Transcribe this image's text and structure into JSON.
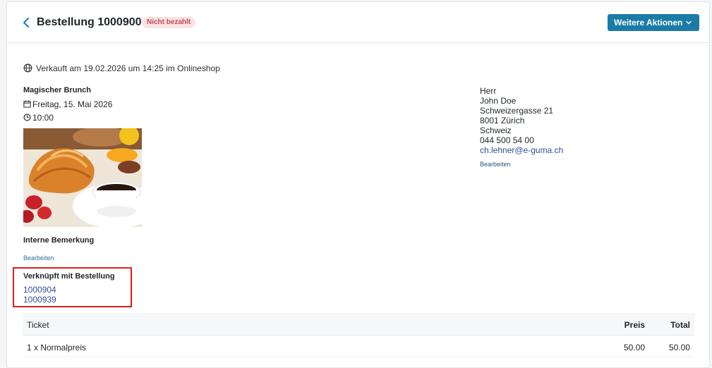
{
  "header": {
    "title": "Bestellung 1000900",
    "badge": "Nicht bezahlt",
    "actions_label": "Weitere Aktionen"
  },
  "sold_info": "Verkauft am 19.02.2026 um 14:25 im Onlineshop",
  "event": {
    "name": "Magischer Brunch",
    "date": "Freitag, 15. Mai 2026",
    "time": "10:00"
  },
  "internal_note": {
    "heading": "Interne Bemerkung",
    "edit_label": "Bearbeiten"
  },
  "linked": {
    "heading": "Verknüpft mit Bestellung",
    "orders": [
      "1000904",
      "1000939"
    ]
  },
  "customer": {
    "salutation": "Herr",
    "name": "John Doe",
    "street": "Schweizergasse 21",
    "city": "8001 Zürich",
    "country": "Schweiz",
    "phone": "044 500 54 00",
    "email": "ch.lehner@e-guma.ch",
    "edit_label": "Bearbeiten"
  },
  "table": {
    "columns": [
      "Ticket",
      "Preis",
      "Total"
    ],
    "rows": [
      {
        "ticket": "1 x Normalpreis",
        "preis": "50.00",
        "total": "50.00"
      }
    ]
  },
  "colors": {
    "primary": "#1a7ca6",
    "badge_bg": "#fbe3e4",
    "badge_text": "#c74a52",
    "link": "#2f4f9a",
    "highlight": "#dc1e1e"
  }
}
